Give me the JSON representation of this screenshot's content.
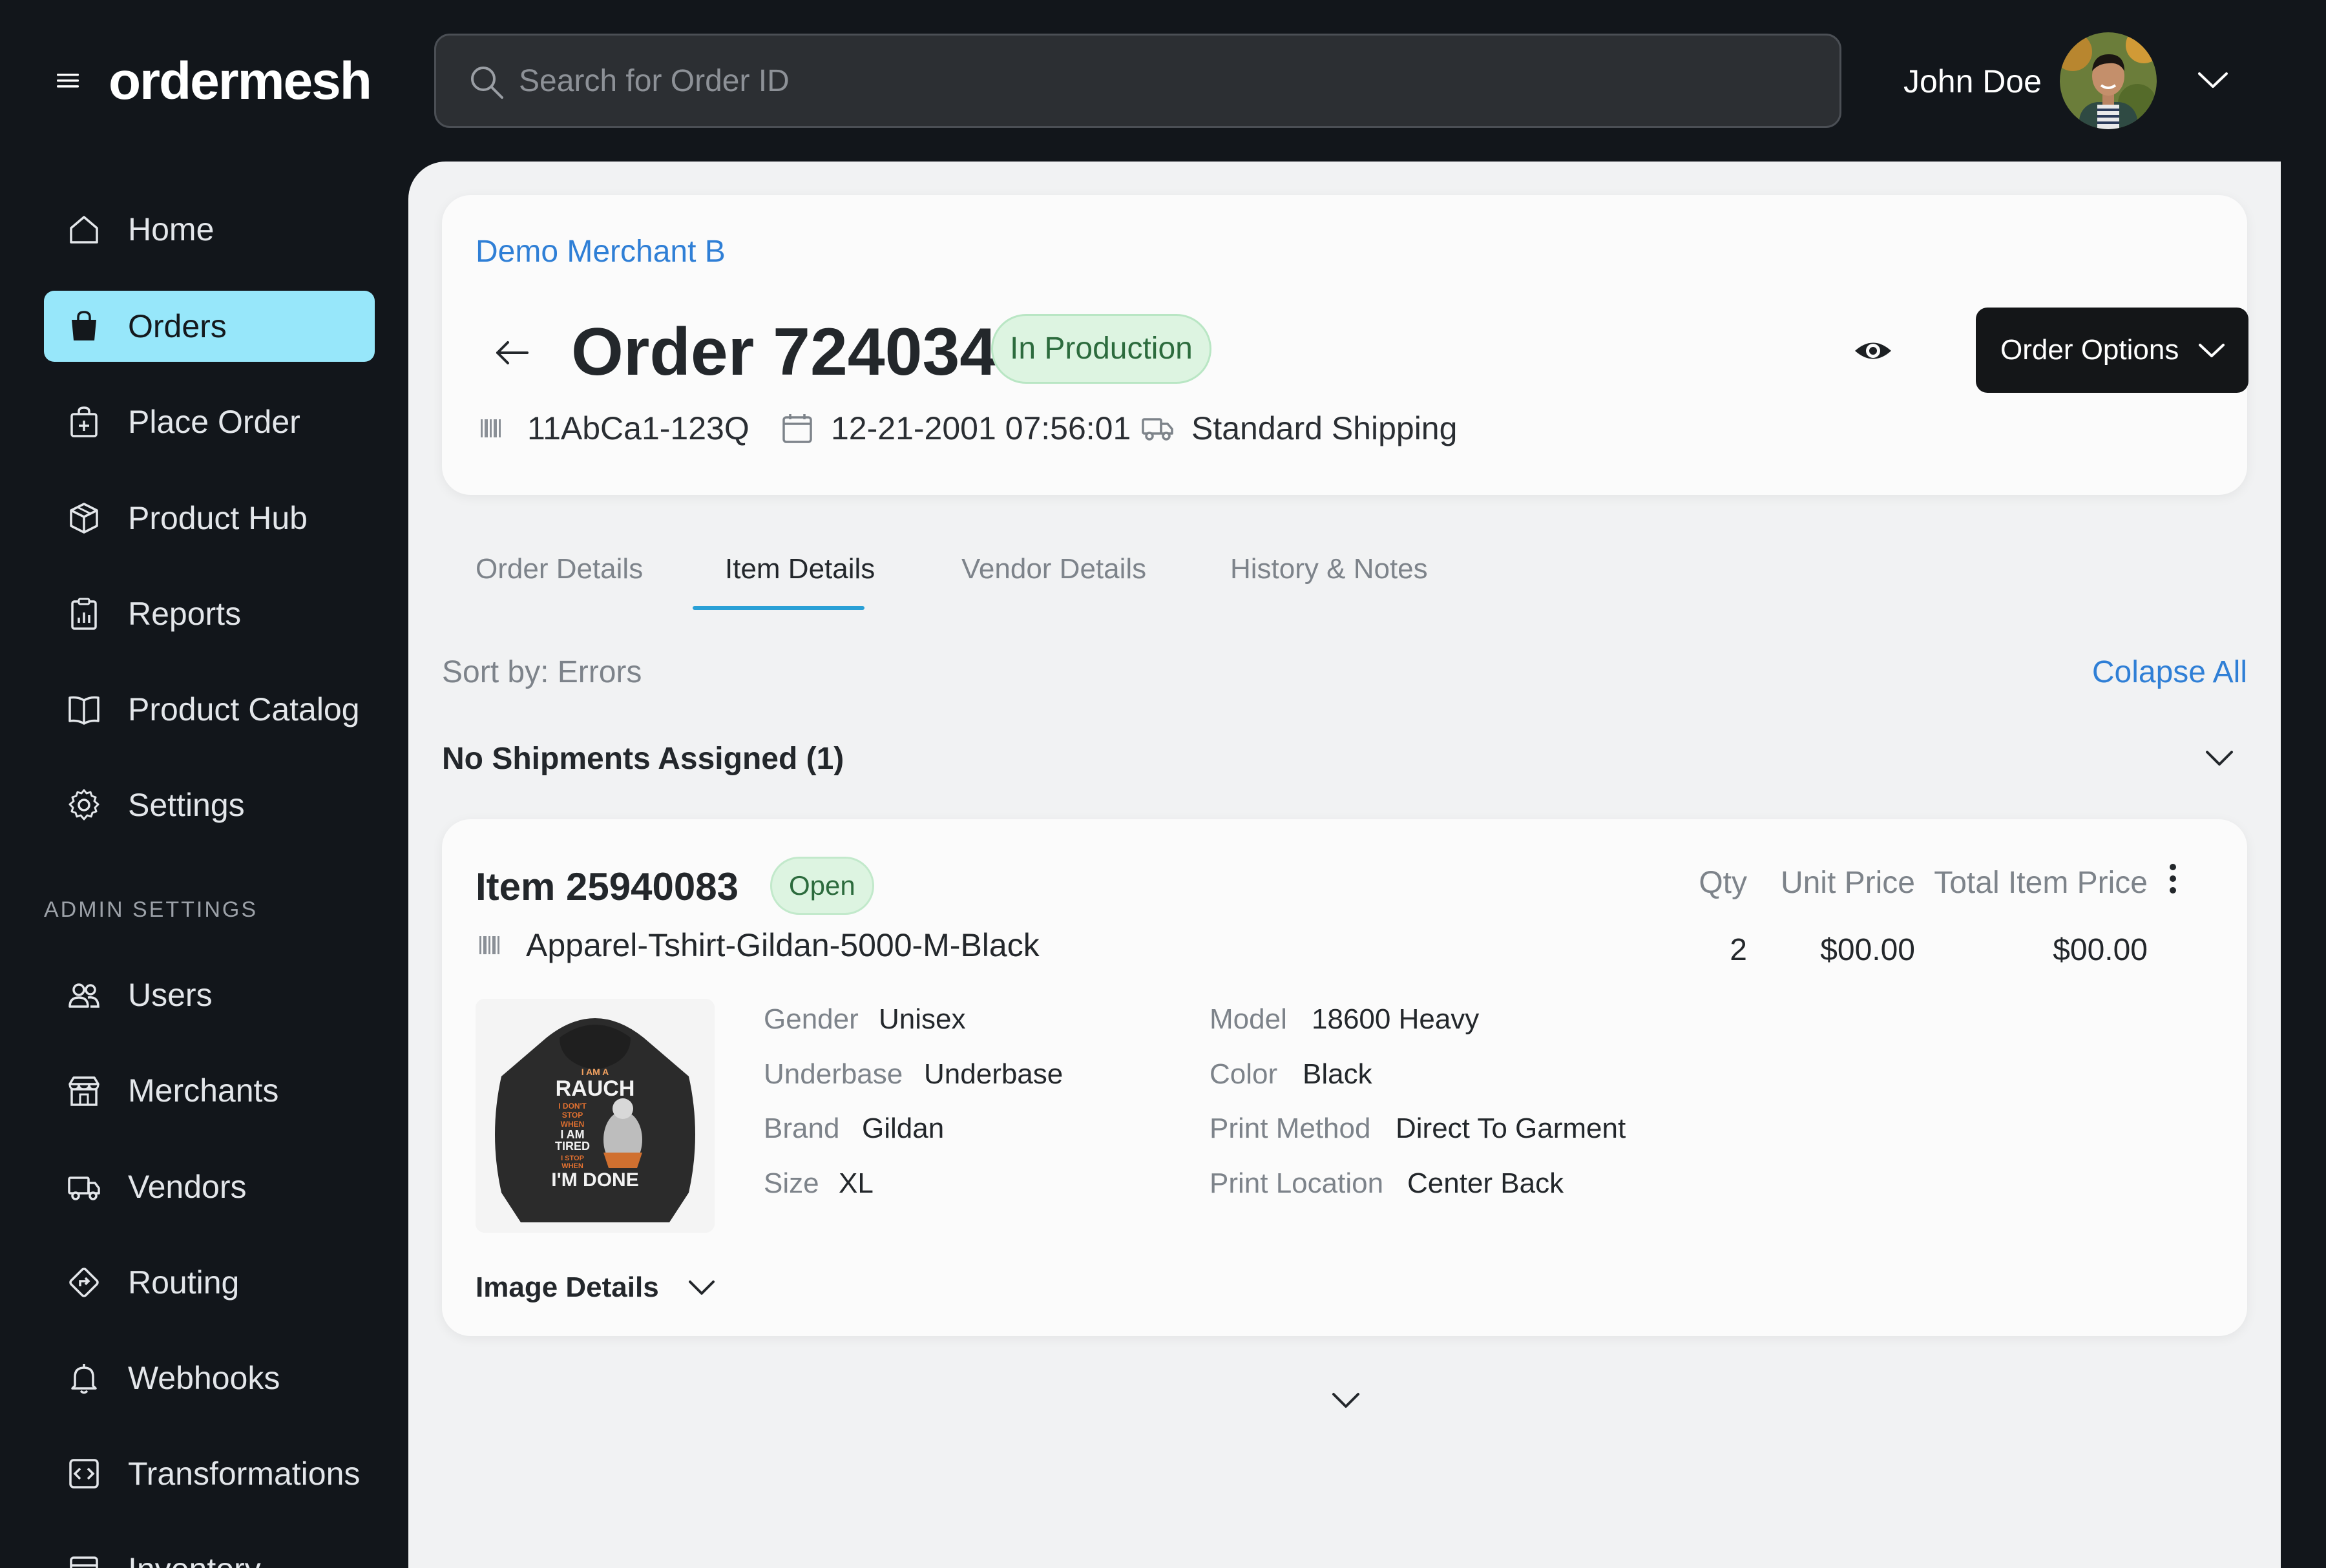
{
  "app": {
    "logo": "ordermesh"
  },
  "search": {
    "placeholder": "Search for Order ID"
  },
  "user": {
    "name": "John Doe"
  },
  "sidebar": {
    "items": [
      {
        "label": "Home",
        "icon": "home-icon",
        "active": false
      },
      {
        "label": "Orders",
        "icon": "shopping-bag-icon",
        "active": true
      },
      {
        "label": "Place Order",
        "icon": "add-bag-icon",
        "active": false
      },
      {
        "label": "Product Hub",
        "icon": "box-icon",
        "active": false
      },
      {
        "label": "Reports",
        "icon": "report-icon",
        "active": false
      },
      {
        "label": "Product Catalog",
        "icon": "book-icon",
        "active": false
      },
      {
        "label": "Settings",
        "icon": "gear-icon",
        "active": false
      }
    ],
    "admin_section_label": "ADMIN SETTINGS",
    "admin_items": [
      {
        "label": "Users",
        "icon": "users-icon"
      },
      {
        "label": "Merchants",
        "icon": "store-icon"
      },
      {
        "label": "Vendors",
        "icon": "truck-icon"
      },
      {
        "label": "Routing",
        "icon": "routing-icon"
      },
      {
        "label": "Webhooks",
        "icon": "bell-icon"
      },
      {
        "label": "Transformations",
        "icon": "code-icon"
      },
      {
        "label": "Inventory",
        "icon": "inventory-icon"
      }
    ]
  },
  "order": {
    "merchant": "Demo Merchant B",
    "title": "Order 724034",
    "status": "In Production",
    "options_label": "Order Options",
    "external_id": "11AbCa1-123Q",
    "date": "12-21-2001 07:56:01",
    "shipping": "Standard Shipping"
  },
  "tabs": [
    {
      "label": "Order Details",
      "active": false
    },
    {
      "label": "Item Details",
      "active": true
    },
    {
      "label": "Vendor Details",
      "active": false
    },
    {
      "label": "History & Notes",
      "active": false
    }
  ],
  "list": {
    "sort_label": "Sort by: Errors",
    "collapse_label": "Colapse All",
    "group_title": "No Shipments Assigned (1)"
  },
  "item": {
    "title": "Item 25940083",
    "status": "Open",
    "sku": "Apparel-Tshirt-Gildan-5000-M-Black",
    "columns": {
      "qty_label": "Qty",
      "unit_price_label": "Unit Price",
      "total_label": "Total Item Price"
    },
    "qty": "2",
    "unit_price": "$00.00",
    "total_price": "$00.00",
    "image_text": [
      "I AM A",
      "RAUCH",
      "I DON'T",
      "STOP",
      "WHEN",
      "I AM",
      "TIRED",
      "I STOP",
      "WHEN",
      "I'M DONE"
    ],
    "attributes_left": [
      {
        "label": "Gender",
        "value": "Unisex"
      },
      {
        "label": "Underbase",
        "value": "Underbase"
      },
      {
        "label": "Brand",
        "value": "Gildan"
      },
      {
        "label": "Size",
        "value": "XL"
      }
    ],
    "attributes_right": [
      {
        "label": "Model",
        "value": "18600 Heavy"
      },
      {
        "label": "Color",
        "value": "Black"
      },
      {
        "label": "Print Method",
        "value": "Direct To Garment"
      },
      {
        "label": "Print Location",
        "value": "Center Back"
      }
    ],
    "image_details_label": "Image Details"
  },
  "colors": {
    "sidebar_bg": "#12161b",
    "active_nav": "#97e7fa",
    "link": "#2f7fd6",
    "status_bg": "#ddf4e1",
    "status_text": "#2c6b3d",
    "tab_accent": "#2aa0d6"
  }
}
